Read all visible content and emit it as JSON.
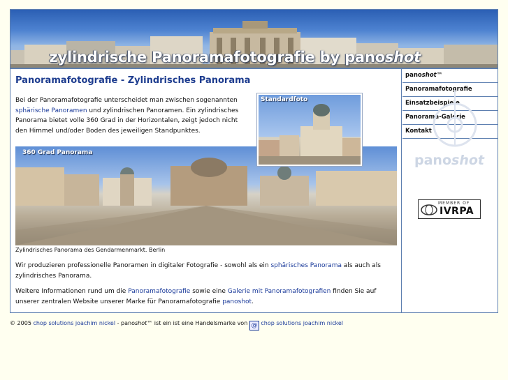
{
  "banner": {
    "title_prefix": "zylindrische Panoramafotografie by pano",
    "title_brand": "shot"
  },
  "main": {
    "title": "Panoramafotografie - Zylindrisches Panorama",
    "intro_1": "Bei der Panoramafotografie unterscheidet man zwischen sogenannten",
    "intro_link": "sphärische Panoramen",
    "intro_2": "und zylindrischen Panoramen. Ein zylindrisches Panorama bietet volle 360 Grad in der Horizontalen, zeigt jedoch nicht den Himmel und/oder Boden des jeweiligen Standpunktes.",
    "standard_photo_label": "Standardfoto",
    "panorama_label": "360 Grad Panorama",
    "panorama_caption": "Zylindrisches Panorama des Gendarmenmarkt. Berlin",
    "para2_1": "Wir produzieren professionelle Panoramen in digitaler Fotografie - sowohl als ein",
    "para2_link": "sphärisches Panorama",
    "para2_2": "als auch als zylindrisches Panorama.",
    "para3_1": "Weitere Informationen rund um die",
    "para3_link1": "Panoramafotografie",
    "para3_2": "sowie eine",
    "para3_link2": "Galerie mit Panoramafotografien",
    "para3_3": "finden Sie auf unserer zentralen Website unserer Marke für Panoramafotografie",
    "para3_link3": "panoshot",
    "para3_4": "."
  },
  "sidebar": {
    "items": [
      {
        "prefix": "pano",
        "brand": "shot",
        "suffix": "™"
      },
      {
        "label": "Panoramafotografie"
      },
      {
        "label": "Einsatzbeispiele"
      },
      {
        "label": "Panorama-Galerie"
      },
      {
        "label": "Kontakt"
      }
    ],
    "logo_prefix": "pano",
    "logo_brand": "shot",
    "ivrpa_member": "MEMBER OF",
    "ivrpa_name": "IVRPA"
  },
  "footer": {
    "copyright": "© 2005",
    "company_link": "chop solutions joachim nickel",
    "text_1": "- pano",
    "brand": "shot",
    "text_2": "™ ist ein ist eine Handelsmarke von",
    "icon_glyph": "@",
    "company_link2": "chop solutions joachim nickel"
  },
  "colors": {
    "accent": "#1e3d8f",
    "border": "#5d7fb0",
    "page_background": "#fffff0"
  }
}
